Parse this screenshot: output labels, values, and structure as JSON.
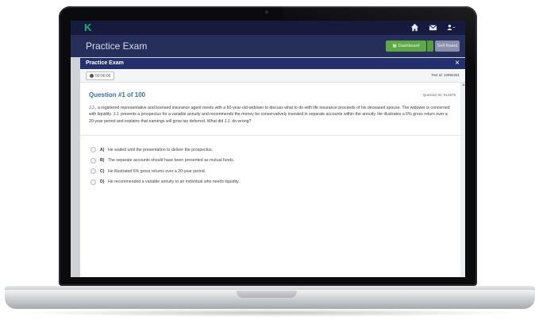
{
  "app": {
    "logo": "K",
    "page_title": "Practice Exam",
    "buttons": {
      "dashboard": "Dashboard",
      "self_rated": "Self Rated"
    },
    "nav_icons": [
      "home-icon",
      "mail-icon",
      "user-icon"
    ]
  },
  "modal": {
    "title": "Practice Exam",
    "close": "×",
    "timer": "00:00:06",
    "test_id": "Test Id: 10892281",
    "question": {
      "heading": "Question #1 of 100",
      "id": "Question ID: 614578",
      "text": "J.J., a registered representative and licensed insurance agent meets with a 60-year-old widower to discuss what to do with life insurance proceeds of his deceased spouse. The widower is concerned with liquidity. J.J. presents a prospectus for a variable annuity and recommends the money be conservatively invested in separate accounts within the annuity. He illustrates a 6% gross return over a 20-year period and explains that earnings will grow tax deferred. What did J.J. do wrong?"
    },
    "answers": [
      {
        "letter": "A)",
        "text": "He waited until the presentation to deliver the prospectus."
      },
      {
        "letter": "B)",
        "text": "The separate accounts should have been presented as mutual funds."
      },
      {
        "letter": "C)",
        "text": "He illustrated 6% gross returns over a 20-year period."
      },
      {
        "letter": "D)",
        "text": "He recommended a variable annuity to an individual who needs liquidity."
      }
    ]
  },
  "colors": {
    "nav_bg": "#161a3d",
    "header_bg": "#262e5a",
    "modal_header": "#23306d",
    "dashboard_btn": "#5fa847",
    "question_title": "#3a6ea8",
    "logo": "#1bb36f"
  }
}
